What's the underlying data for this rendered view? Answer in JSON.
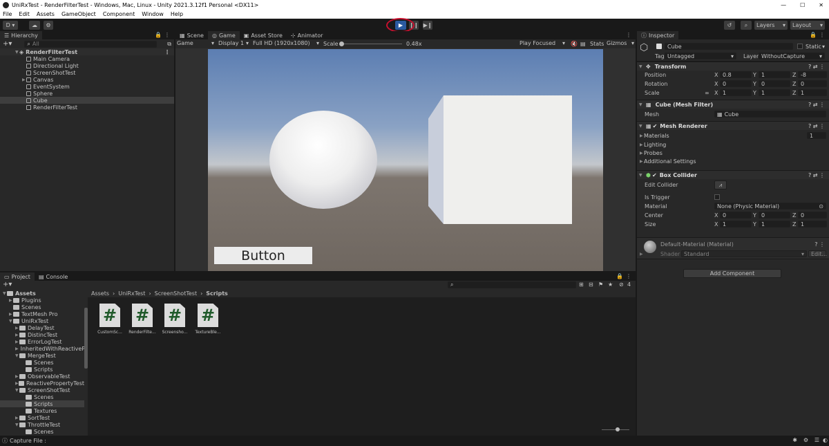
{
  "window": {
    "title": "UniRxTest - RenderFilterTest - Windows, Mac, Linux - Unity 2021.3.12f1 Personal <DX11>",
    "min": "—",
    "max": "☐",
    "close": "✕"
  },
  "menu": [
    "File",
    "Edit",
    "Assets",
    "GameObject",
    "Component",
    "Window",
    "Help"
  ],
  "toolbar": {
    "account": "D",
    "layers": "Layers",
    "layout": "Layout"
  },
  "hierarchy": {
    "tab": "Hierarchy",
    "search_placeholder": "All",
    "root": "RenderFilterTest",
    "items": [
      "Main Camera",
      "Directional Light",
      "ScreenShotTest",
      "Canvas",
      "EventSystem",
      "Sphere",
      "Cube",
      "RenderFilterTest"
    ]
  },
  "center": {
    "tabs": [
      "Scene",
      "Game",
      "Asset Store",
      "Animator"
    ],
    "game_toolbar": {
      "display_mode": "Game",
      "display": "Display 1",
      "resolution": "Full HD (1920x1080)",
      "scale_label": "Scale",
      "scale_value": "0.48x",
      "play_focused": "Play Focused",
      "stats": "Stats",
      "gizmos": "Gizmos"
    },
    "button_label": "Button"
  },
  "project": {
    "tabs": [
      "Project",
      "Console"
    ],
    "count": "4",
    "breadcrumb": [
      "Assets",
      "UniRxTest",
      "ScreenShotTest",
      "Scripts"
    ],
    "tree": [
      {
        "label": "Assets",
        "depth": 0,
        "arrow": "▼"
      },
      {
        "label": "Plugins",
        "depth": 1,
        "arrow": "▶"
      },
      {
        "label": "Scenes",
        "depth": 1,
        "arrow": ""
      },
      {
        "label": "TextMesh Pro",
        "depth": 1,
        "arrow": "▶"
      },
      {
        "label": "UniRxTest",
        "depth": 1,
        "arrow": "▼"
      },
      {
        "label": "DelayTest",
        "depth": 2,
        "arrow": "▶"
      },
      {
        "label": "DistincTest",
        "depth": 2,
        "arrow": "▶"
      },
      {
        "label": "ErrorLogTest",
        "depth": 2,
        "arrow": "▶"
      },
      {
        "label": "InheritedWithReactiveP",
        "depth": 2,
        "arrow": "▶"
      },
      {
        "label": "MergeTest",
        "depth": 2,
        "arrow": "▼"
      },
      {
        "label": "Scenes",
        "depth": 3,
        "arrow": ""
      },
      {
        "label": "Scripts",
        "depth": 3,
        "arrow": ""
      },
      {
        "label": "ObservableTest",
        "depth": 2,
        "arrow": "▶"
      },
      {
        "label": "ReactivePropertyTest",
        "depth": 2,
        "arrow": "▶"
      },
      {
        "label": "ScreenShotTest",
        "depth": 2,
        "arrow": "▼"
      },
      {
        "label": "Scenes",
        "depth": 3,
        "arrow": ""
      },
      {
        "label": "Scripts",
        "depth": 3,
        "arrow": ""
      },
      {
        "label": "Textures",
        "depth": 3,
        "arrow": ""
      },
      {
        "label": "SortTest",
        "depth": 2,
        "arrow": "▶"
      },
      {
        "label": "ThrottleTest",
        "depth": 2,
        "arrow": "▼"
      },
      {
        "label": "Scenes",
        "depth": 3,
        "arrow": ""
      }
    ],
    "assets": [
      "CustomSc...",
      "RenderFilte...",
      "Screensho...",
      "TextureBle..."
    ]
  },
  "inspector": {
    "tab": "Inspector",
    "name": "Cube",
    "static": "Static",
    "tag_label": "Tag",
    "tag": "Untagged",
    "layer_label": "Layer",
    "layer": "WithoutCapture",
    "transform": {
      "title": "Transform",
      "position": "Position",
      "rotation": "Rotation",
      "scale": "Scale",
      "pos": [
        "0.8",
        "1",
        "-8"
      ],
      "rot": [
        "0",
        "0",
        "0"
      ],
      "scl": [
        "1",
        "1",
        "1"
      ]
    },
    "mesh_filter": {
      "title": "Cube (Mesh Filter)",
      "mesh_label": "Mesh",
      "mesh": "Cube"
    },
    "mesh_renderer": {
      "title": "Mesh Renderer",
      "materials": "Materials",
      "materials_count": "1",
      "lighting": "Lighting",
      "probes": "Probes",
      "additional": "Additional Settings"
    },
    "box_collider": {
      "title": "Box Collider",
      "edit": "Edit Collider",
      "is_trigger": "Is Trigger",
      "material": "Material",
      "material_value": "None (Physic Material)",
      "center": "Center",
      "size": "Size",
      "center_v": [
        "0",
        "0",
        "0"
      ],
      "size_v": [
        "1",
        "1",
        "1"
      ]
    },
    "material": {
      "title": "Default-Material (Material)",
      "shader_label": "Shader",
      "shader": "Standard",
      "edit": "Edit..."
    },
    "add_component": "Add Component"
  },
  "status": {
    "text": "Capture File :"
  },
  "axes": [
    "X",
    "Y",
    "Z"
  ]
}
